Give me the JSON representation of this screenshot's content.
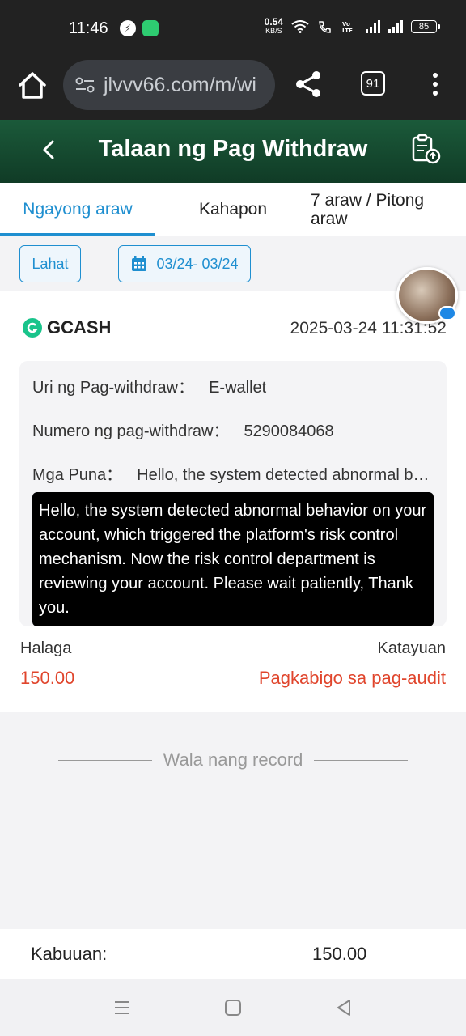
{
  "status_bar": {
    "time": "11:46",
    "speed_value": "0.54",
    "speed_unit": "KB/S",
    "battery": "85"
  },
  "browser": {
    "url": "jlvvv66.com/m/wi",
    "tab_count": "91"
  },
  "header": {
    "title": "Talaan ng Pag Withdraw"
  },
  "tabs": [
    {
      "label": "Ngayong araw",
      "active": true
    },
    {
      "label": "Kahapon",
      "active": false
    },
    {
      "label": "7 araw / Pitong araw",
      "active": false
    }
  ],
  "filters": {
    "all_label": "Lahat",
    "date_range": "03/24- 03/24"
  },
  "record": {
    "provider": "GCASH",
    "datetime": "2025-03-24 11:31:52",
    "type_label": "Uri ng Pag-withdraw：",
    "type_value": "E-wallet",
    "number_label": "Numero ng pag-withdraw：",
    "number_value": "5290084068",
    "remark_label": "Mga Puna：",
    "remark_value": "Hello, the system detected abnormal behavior on your account, which triggered the platform's risk control mechanism. Now the risk control department is reviewing your account. Please wait patiently, Thank you.",
    "tooltip": "Hello, the system detected abnormal behavior on your account, which triggered the platform's risk control mechanism. Now the risk control department is reviewing your account. Please wait patiently, Thank you.",
    "amount_label": "Halaga",
    "amount_value": "150.00",
    "status_label": "Katayuan",
    "status_value": "Pagkabigo sa pag-audit"
  },
  "empty_text": "Wala nang record",
  "total": {
    "label": "Kabuuan:",
    "value": "150.00"
  },
  "colors": {
    "accent": "#1f8fd0",
    "header_green": "#1b5a3a",
    "error_red": "#e0452c",
    "gcash_green": "#19c48b"
  }
}
